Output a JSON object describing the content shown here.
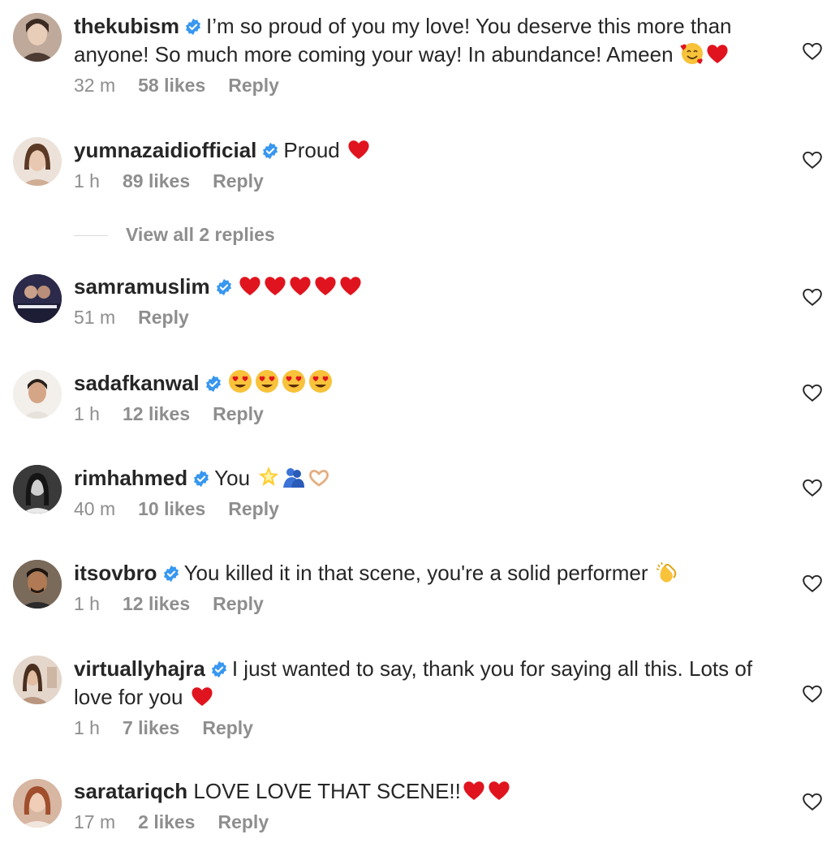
{
  "colors": {
    "text": "#262626",
    "meta": "#8e8e8e",
    "verified": "#3897f0",
    "heart_red": "#e0141e"
  },
  "icons": {
    "verified": "verified-badge-icon",
    "like": "heart-outline-icon"
  },
  "comments": [
    {
      "username": "thekubism",
      "text": "I’m so proud of you my love! You deserve this more than anyone! So much more coming your way! In abundance! Ameen",
      "emojis": [
        "smiling-face-with-hearts-emoji",
        "red-heart-emoji"
      ],
      "time": "32 m",
      "likes": "58 likes",
      "reply": "Reply"
    },
    {
      "username": "yumnazaidiofficial",
      "text": "Proud",
      "emojis": [
        "red-heart-emoji"
      ],
      "time": "1 h",
      "likes": "89 likes",
      "reply": "Reply",
      "view_replies": "View all 2 replies"
    },
    {
      "username": "samramuslim",
      "text": "",
      "emojis": [
        "red-heart-emoji",
        "red-heart-emoji",
        "red-heart-emoji",
        "red-heart-emoji",
        "red-heart-emoji"
      ],
      "time": "51 m",
      "reply": "Reply"
    },
    {
      "username": "sadafkanwal",
      "text": "",
      "emojis": [
        "heart-eyes-emoji",
        "heart-eyes-emoji",
        "heart-eyes-emoji",
        "heart-eyes-emoji"
      ],
      "time": "1 h",
      "likes": "12 likes",
      "reply": "Reply"
    },
    {
      "username": "rimhahmed",
      "text": "You",
      "emojis": [
        "glowing-star-emoji",
        "people-hugging-emoji",
        "heart-hands-emoji"
      ],
      "time": "40 m",
      "likes": "10 likes",
      "reply": "Reply"
    },
    {
      "username": "itsovbro",
      "text": "You killed it in that scene, you're a solid performer",
      "emojis": [
        "clapping-hands-emoji"
      ],
      "time": "1 h",
      "likes": "12 likes",
      "reply": "Reply"
    },
    {
      "username": "virtuallyhajra",
      "text": "I just wanted to say, thank you for saying all this. Lots of love for you",
      "emojis": [
        "red-heart-emoji"
      ],
      "time": "1 h",
      "likes": "7 likes",
      "reply": "Reply"
    },
    {
      "username": "saratariqch",
      "text": "LOVE LOVE THAT SCENE!!",
      "emojis": [
        "red-heart-emoji",
        "red-heart-emoji"
      ],
      "time": "17 m",
      "likes": "2 likes",
      "reply": "Reply"
    }
  ]
}
